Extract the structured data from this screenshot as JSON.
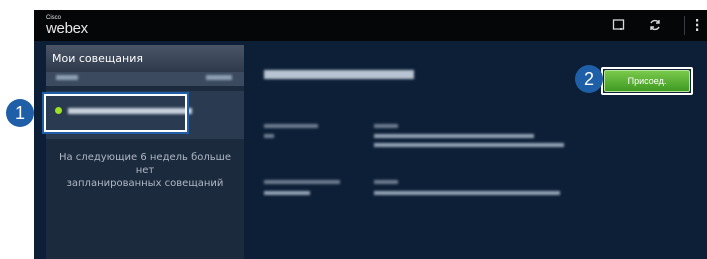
{
  "app": {
    "logo_cisco": "Cisco",
    "logo_webex": "webex"
  },
  "toolbar": {
    "icons": [
      "new-meeting-icon",
      "refresh-icon",
      "overflow-menu-icon"
    ]
  },
  "sidebar": {
    "title": "Мои совещания",
    "empty_message": "На следующие 6 недель больше нет\nзапланированных совещаний"
  },
  "meeting": {
    "status_color": "#9be21f"
  },
  "actions": {
    "join_label": "Присоед."
  },
  "callouts": [
    "1",
    "2"
  ],
  "colors": {
    "accent_green": "#5cb336",
    "callout_blue": "#1f5fa8",
    "background": "#0c1f36"
  }
}
